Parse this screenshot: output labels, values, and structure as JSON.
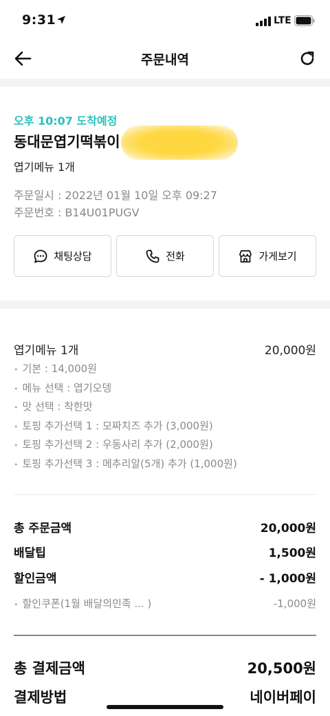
{
  "status_bar": {
    "time": "9:31",
    "network": "LTE"
  },
  "nav": {
    "title": "주문내역"
  },
  "order": {
    "eta": "오후 10:07 도착예정",
    "store_name": "동대문엽기떡볶이",
    "menu_summary": "엽기메뉴 1개",
    "order_date": "주문일시 : 2022년 01월 10일 오후 09:27",
    "order_number": "주문번호 : B14U01PUGV"
  },
  "actions": {
    "chat": "채팅상담",
    "call": "전화",
    "store": "가게보기"
  },
  "item": {
    "name": "엽기메뉴 1개",
    "price": "20,000원",
    "options": [
      "기본 : 14,000원",
      "메뉴 선택 : 엽기오뎅",
      "맛 선택 : 착한맛",
      "토핑 추가선택 1 : 모짜치즈 추가 (3,000원)",
      "토핑 추가선택 2 : 우동사리 추가 (2,000원)",
      "토핑 추가선택 3 : 메추리알(5개) 추가 (1,000원)"
    ]
  },
  "summary": {
    "total_order_label": "총 주문금액",
    "total_order_value": "20,000원",
    "tip_label": "배달팁",
    "tip_value": "1,500원",
    "discount_label": "할인금액",
    "discount_value": "- 1,000원",
    "coupon_label": "할인쿠폰(1월 배달의민족 ... )",
    "coupon_value": "-1,000원"
  },
  "payment": {
    "total_label": "총 결제금액",
    "total_value": "20,500원",
    "method_label": "결제방법",
    "method_value": "네이버페이"
  },
  "colors": {
    "accent": "#2ac1bc",
    "redaction": "#ffd740"
  }
}
